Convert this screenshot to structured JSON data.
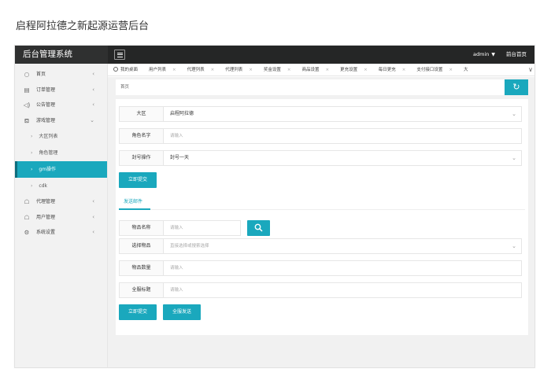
{
  "caption": "启程阿拉德之新起源运营后台",
  "header": {
    "brand": "后台管理系统",
    "user": "admin",
    "user_caret": "▼",
    "home_link": "前台首页"
  },
  "sidebar": {
    "items": [
      {
        "label": "首页",
        "icon": "○",
        "arrow": "‹"
      },
      {
        "label": "订单管理",
        "icon": "▤",
        "arrow": "‹"
      },
      {
        "label": "公告管理",
        "icon": "◁)",
        "arrow": "‹"
      },
      {
        "label": "游戏管理",
        "icon": "⛾",
        "arrow": "⌄"
      }
    ],
    "subitems": [
      {
        "label": "大区列表"
      },
      {
        "label": "角色管理"
      },
      {
        "label": "gm操作"
      },
      {
        "label": "cdk"
      }
    ],
    "items_after": [
      {
        "label": "代理管理",
        "icon": "☖",
        "arrow": "‹"
      },
      {
        "label": "用户管理",
        "icon": "☖",
        "arrow": "‹"
      },
      {
        "label": "系统设置",
        "icon": "⚙",
        "arrow": "‹"
      }
    ]
  },
  "tabs": {
    "home": "我的桌面",
    "close": "×",
    "items": [
      "用户列表",
      "代理列表",
      "代理列表",
      "奖金设置",
      "商品设置",
      "更充设置",
      "每日更充",
      "支付接口设置"
    ],
    "overflow": "大",
    "expand": "∨"
  },
  "breadcrumb": "首页",
  "refresh_icon": "↻",
  "form": {
    "region": {
      "label": "大区",
      "value": "启程阿拉德",
      "dropdown": "⌄"
    },
    "role_name": {
      "label": "角色名字",
      "placeholder": "请输入"
    },
    "ban_op": {
      "label": "封号操作",
      "value": "封号一天",
      "dropdown": "⌄"
    },
    "submit1": "立即提交",
    "subtab": "发送邮件",
    "item_name": {
      "label": "物品名称",
      "placeholder": "请输入"
    },
    "item_select": {
      "label": "选择物品",
      "placeholder": "直接选择或搜索选择",
      "dropdown": "⌄"
    },
    "item_qty": {
      "label": "物品数量",
      "placeholder": "请输入"
    },
    "mail_title": {
      "label": "全服标题",
      "placeholder": "请输入"
    },
    "submit2": "立即提交",
    "send_all": "全服发送"
  },
  "colors": {
    "accent": "#1aa8bd",
    "topbar": "#252626",
    "sidebar": "#f2f2f2"
  }
}
